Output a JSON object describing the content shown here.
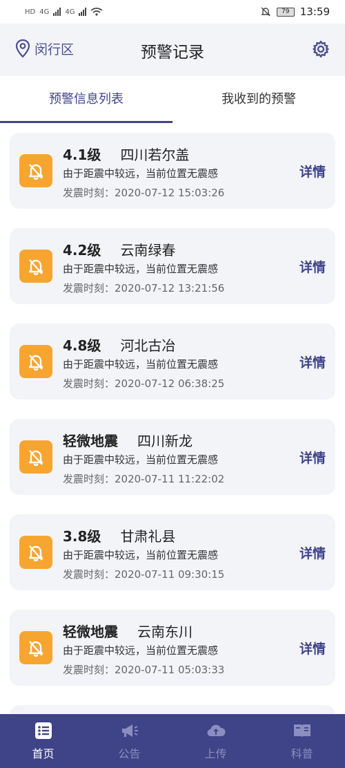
{
  "status_bar": {
    "left_labels": [
      "HD",
      "4G",
      "4G"
    ],
    "battery": "79",
    "time": "13:59"
  },
  "header": {
    "location": "闵行区",
    "title": "预警记录",
    "settings_icon": "gear-icon",
    "location_icon": "location-pin-icon"
  },
  "tabs": [
    {
      "label": "预警信息列表",
      "active": true
    },
    {
      "label": "我收到的预警",
      "active": false
    }
  ],
  "records": [
    {
      "magnitude": "4.1级",
      "place": "四川若尔盖",
      "desc": "由于距震中较远，当前位置无震感",
      "time": "发震时刻：2020-07-12 15:03:26",
      "detail": "详情"
    },
    {
      "magnitude": "4.2级",
      "place": "云南绿春",
      "desc": "由于距震中较远，当前位置无震感",
      "time": "发震时刻：2020-07-12 13:21:56",
      "detail": "详情"
    },
    {
      "magnitude": "4.8级",
      "place": "河北古冶",
      "desc": "由于距震中较远，当前位置无震感",
      "time": "发震时刻：2020-07-12 06:38:25",
      "detail": "详情"
    },
    {
      "magnitude": "轻微地震",
      "place": "四川新龙",
      "desc": "由于距震中较远，当前位置无震感",
      "time": "发震时刻：2020-07-11 11:22:02",
      "detail": "详情"
    },
    {
      "magnitude": "3.8级",
      "place": "甘肃礼县",
      "desc": "由于距震中较远，当前位置无震感",
      "time": "发震时刻：2020-07-11 09:30:15",
      "detail": "详情"
    },
    {
      "magnitude": "轻微地震",
      "place": "云南东川",
      "desc": "由于距震中较远，当前位置无震感",
      "time": "发震时刻：2020-07-11 05:03:33",
      "detail": "详情"
    }
  ],
  "bottom_nav": [
    {
      "label": "首页",
      "icon": "home-list-icon",
      "active": true
    },
    {
      "label": "公告",
      "icon": "megaphone-icon",
      "active": false
    },
    {
      "label": "上传",
      "icon": "cloud-upload-icon",
      "active": false
    },
    {
      "label": "科普",
      "icon": "book-icon",
      "active": false
    }
  ],
  "colors": {
    "accent": "#3f4388",
    "bell_bg": "#f7a531",
    "card_bg": "#f3f4f8"
  }
}
